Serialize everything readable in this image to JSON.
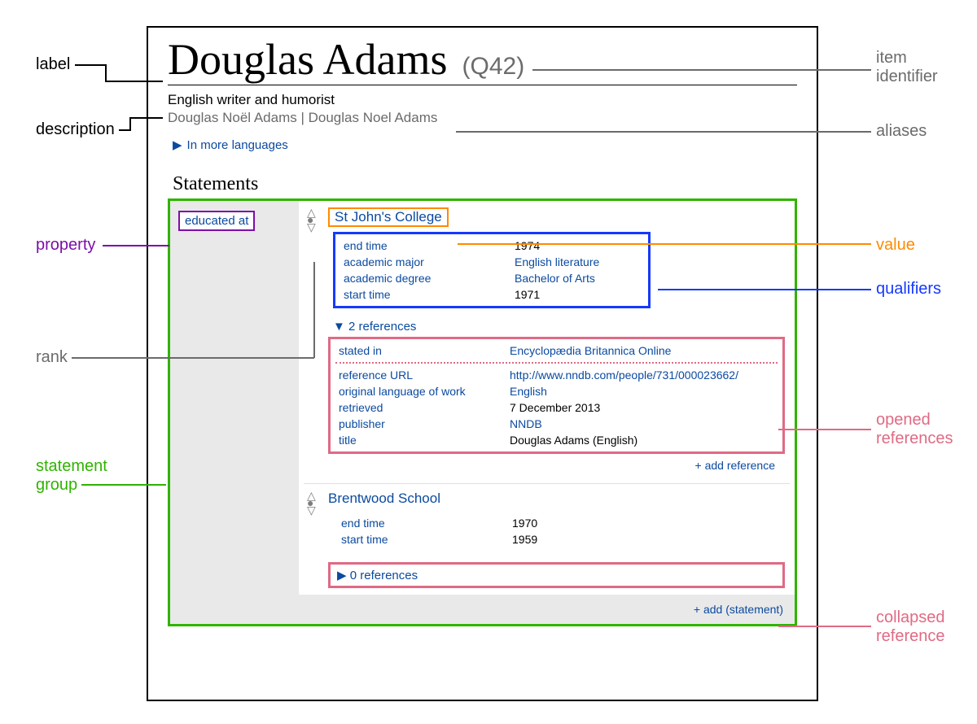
{
  "annotations": {
    "label": "label",
    "item_identifier_l1": "item",
    "item_identifier_l2": "identifier",
    "description": "description",
    "aliases": "aliases",
    "property": "property",
    "rank": "rank",
    "statement_group_l1": "statement",
    "statement_group_l2": "group",
    "value": "value",
    "qualifiers": "qualifiers",
    "opened_references_l1": "opened",
    "opened_references_l2": "references",
    "collapsed_reference_l1": "collapsed",
    "collapsed_reference_l2": "reference"
  },
  "item": {
    "label": "Douglas Adams",
    "qid": "(Q42)",
    "description": "English writer and humorist",
    "aliases": "Douglas Noël Adams | Douglas Noel Adams",
    "more_languages": "In more languages"
  },
  "statements_heading": "Statements",
  "property_label": "educated at",
  "value1": {
    "name": "St John's College",
    "qualifiers": [
      {
        "k": "end time",
        "v": "1974",
        "link": false
      },
      {
        "k": "academic major",
        "v": "English literature",
        "link": true
      },
      {
        "k": "academic degree",
        "v": "Bachelor of Arts",
        "link": true
      },
      {
        "k": "start time",
        "v": "1971",
        "link": false
      }
    ],
    "refs_toggle": "2 references",
    "refs": {
      "block1": [
        {
          "k": "stated in",
          "v": "Encyclopædia Britannica Online",
          "link": true
        }
      ],
      "block2": [
        {
          "k": "reference URL",
          "v": "http://www.nndb.com/people/731/000023662/",
          "link": true
        },
        {
          "k": "original language of work",
          "v": "English",
          "link": true
        },
        {
          "k": "retrieved",
          "v": "7 December 2013",
          "link": false
        },
        {
          "k": "publisher",
          "v": "NNDB",
          "link": true
        },
        {
          "k": "title",
          "v": "Douglas Adams (English)",
          "link": false
        }
      ]
    },
    "add_reference": "+  add reference"
  },
  "value2": {
    "name": "Brentwood School",
    "qualifiers": [
      {
        "k": "end time",
        "v": "1970",
        "link": false
      },
      {
        "k": "start time",
        "v": "1959",
        "link": false
      }
    ],
    "refs_toggle": "0 references"
  },
  "add_statement": "+  add (statement)"
}
